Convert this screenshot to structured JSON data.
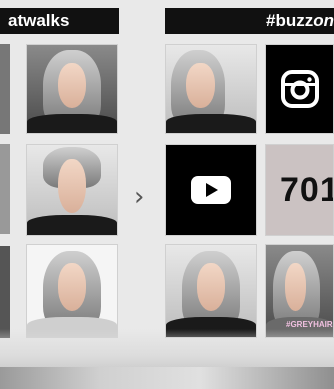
{
  "panels": {
    "left": {
      "header": "atwalks"
    },
    "right": {
      "header_prefix": "#buzz",
      "header_suffix": "on"
    }
  },
  "icons": {
    "instagram": "instagram-icon",
    "youtube": "youtube-icon",
    "next": "chevron-right-icon"
  },
  "counter": {
    "value": "701"
  },
  "chevron": "›",
  "tag": "#GREYHAIR",
  "colors": {
    "header_bg": "#111111",
    "tile_black": "#000000",
    "counter_bg": "#cbc2c2"
  }
}
